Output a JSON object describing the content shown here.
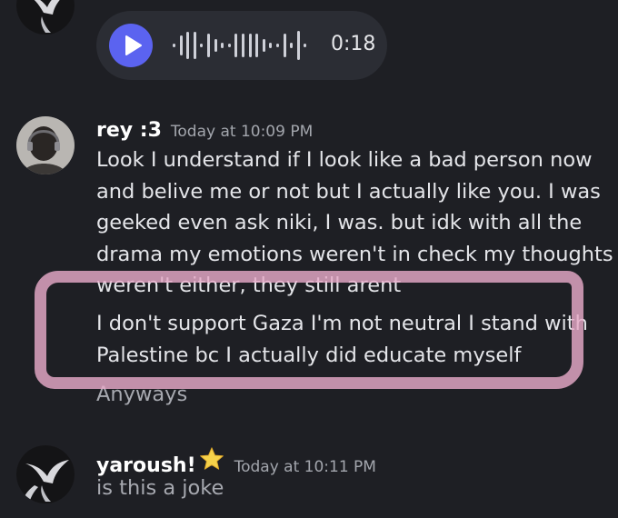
{
  "voice_message": {
    "duration": "0:18"
  },
  "messages": [
    {
      "username": "rey :3",
      "timestamp": "Today at 10:09 PM",
      "lines": [
        "Look I understand if I look like a bad person now",
        "and belive me or not but I actually like you. I was",
        "geeked even ask niki, I was. but idk with all the",
        "drama my emotions weren't in check my thoughts",
        "weren't either, they still arent"
      ],
      "second_paragraph": [
        "I don't support Gaza I'm not neutral I stand with",
        "Palestine bc I actually did educate myself"
      ],
      "third_paragraph": "Anyways"
    },
    {
      "username": "yaroush!",
      "timestamp": "Today at 10:11 PM",
      "text": "is this a joke"
    }
  ],
  "icons": {
    "play": "play-icon",
    "waveform": "waveform-icon",
    "star": "star-emoji"
  },
  "colors": {
    "background": "#1e1f24",
    "play_button": "#5b63f0",
    "highlight": "#e7aac8"
  }
}
